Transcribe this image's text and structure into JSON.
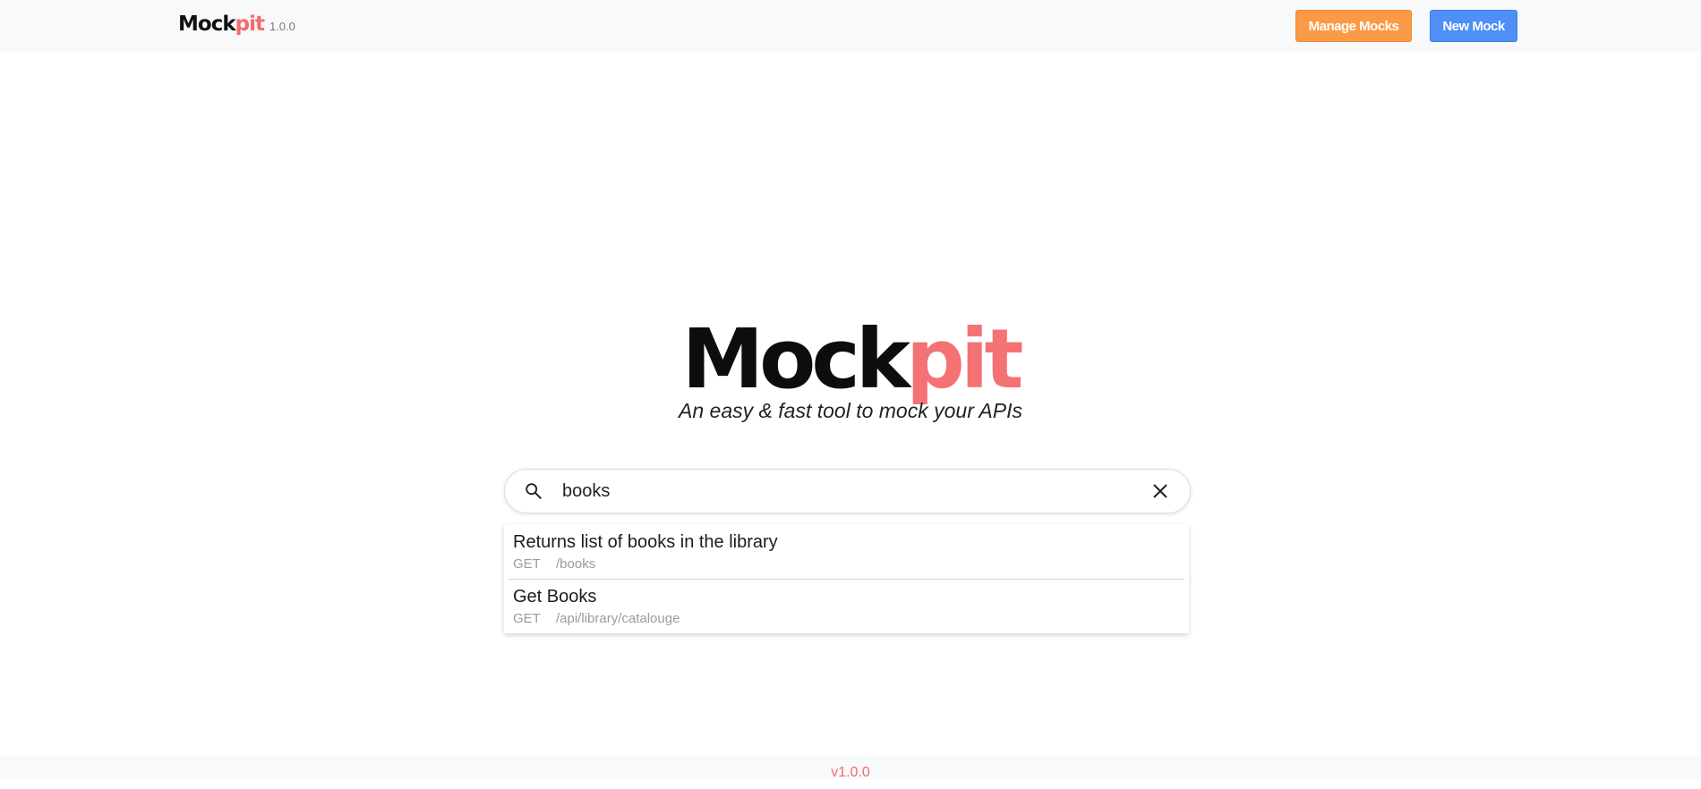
{
  "header": {
    "brand_mock": "Mock",
    "brand_pit": "pit",
    "version": "1.0.0",
    "manage_label": "Manage Mocks",
    "new_label": "New Mock"
  },
  "hero": {
    "title_mock": "Mock",
    "title_pit": "pit",
    "tagline": "An easy & fast tool to mock your APIs"
  },
  "search": {
    "value": "books",
    "icon": "search-icon",
    "clear_icon": "close-icon"
  },
  "results": [
    {
      "title": "Returns list of books in the library",
      "method": "GET",
      "path": "/books"
    },
    {
      "title": "Get Books",
      "method": "GET",
      "path": "/api/library/catalouge"
    }
  ],
  "footer": {
    "version": "v1.0.0"
  },
  "colors": {
    "accent_red": "#f46b6b",
    "manage_orange": "#fb9a46",
    "new_blue": "#4f8ff7"
  }
}
